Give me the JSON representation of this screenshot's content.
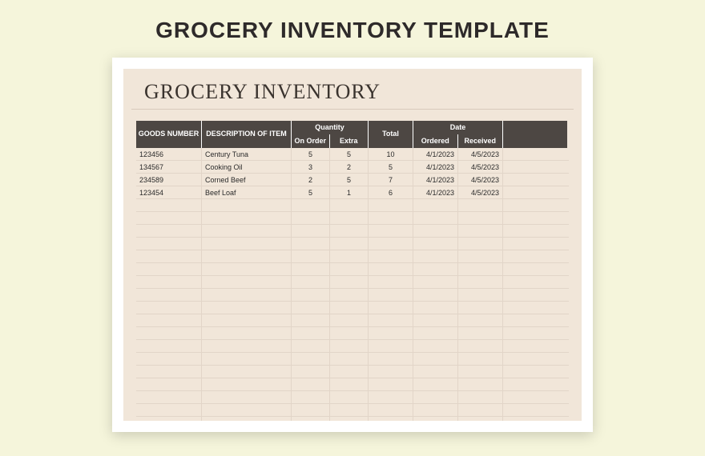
{
  "page_title": "GROCERY INVENTORY TEMPLATE",
  "doc_title": "GROCERY INVENTORY",
  "headers": {
    "goods_number": "GOODS NUMBER",
    "description": "DESCRIPTION OF ITEM",
    "quantity": "Quantity",
    "on_order": "On Order",
    "extra": "Extra",
    "total": "Total",
    "date": "Date",
    "ordered": "Ordered",
    "received": "Received"
  },
  "rows": [
    {
      "goods": "123456",
      "desc": "Century Tuna",
      "on_order": "5",
      "extra": "5",
      "total": "10",
      "ordered": "4/1/2023",
      "received": "4/5/2023"
    },
    {
      "goods": "134567",
      "desc": "Cooking Oil",
      "on_order": "3",
      "extra": "2",
      "total": "5",
      "ordered": "4/1/2023",
      "received": "4/5/2023"
    },
    {
      "goods": "234589",
      "desc": "Corned Beef",
      "on_order": "2",
      "extra": "5",
      "total": "7",
      "ordered": "4/1/2023",
      "received": "4/5/2023"
    },
    {
      "goods": "123454",
      "desc": "Beef Loaf",
      "on_order": "5",
      "extra": "1",
      "total": "6",
      "ordered": "4/1/2023",
      "received": "4/5/2023"
    }
  ],
  "empty_rows": 18
}
